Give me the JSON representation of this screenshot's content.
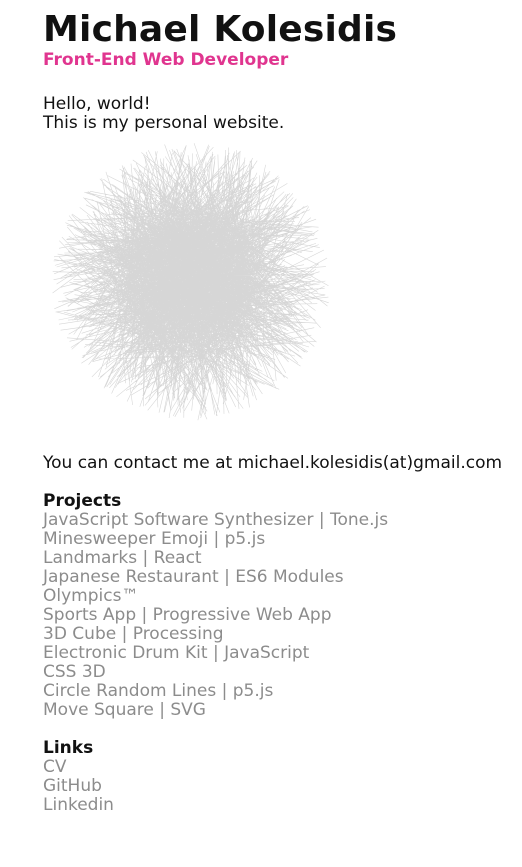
{
  "header": {
    "name": "Michael Kolesidis",
    "role": "Front-End Web Developer"
  },
  "intro": {
    "line1": "Hello, world!",
    "line2": "This is my personal website."
  },
  "contact": "You can contact me at michael.kolesidis(at)gmail.com",
  "projects": {
    "title": "Projects",
    "items": [
      "JavaScript Software Synthesizer | Tone.js",
      "Minesweeper Emoji | p5.js",
      "Landmarks | React",
      "Japanese Restaurant | ES6 Modules",
      "Olympics™",
      "Sports App | Progressive Web App",
      "3D Cube | Processing",
      "Electronic Drum Kit | JavaScript",
      "CSS 3D",
      "Circle Random Lines | p5.js",
      "Move Square | SVG"
    ]
  },
  "links": {
    "title": "Links",
    "items": [
      "CV",
      "GitHub",
      "Linkedin"
    ]
  },
  "colors": {
    "accent": "#e0358f",
    "link": "#8c8c8c",
    "text": "#111111"
  }
}
